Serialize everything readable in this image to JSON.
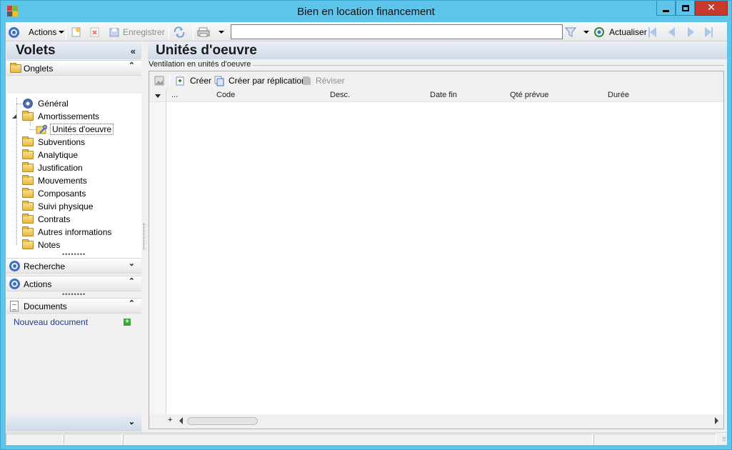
{
  "window": {
    "title": "Bien en location financement",
    "close_glyph": "✕"
  },
  "toolbar": {
    "actions_label": "Actions",
    "save_label": "Enregistrer",
    "search_value": "",
    "refresh_label": "Actualiser"
  },
  "left_pane": {
    "title": "Volets",
    "collapse_glyph": "«",
    "sections": {
      "tabs": {
        "label": "Onglets",
        "chevron": "⌃"
      },
      "search": {
        "label": "Recherche",
        "chevron": "⌄"
      },
      "actions": {
        "label": "Actions",
        "chevron": "⌃"
      },
      "documents": {
        "label": "Documents",
        "chevron": "⌃"
      }
    },
    "tree": [
      "Général",
      "Amortissements",
      "Unités d'oeuvre",
      "Subventions",
      "Analytique",
      "Justification",
      "Mouvements",
      "Composants",
      "Suivi physique",
      "Contrats",
      "Autres informations",
      "Notes"
    ],
    "documents_link": "Nouveau document",
    "bottom_chevron": "⌄"
  },
  "main": {
    "title": "Unités d'oeuvre",
    "group_label": "Ventilation en unités d'oeuvre",
    "grid_tools": {
      "create": "Créer",
      "create_replication": "Créer par réplication",
      "revise": "Réviser"
    },
    "columns": [
      "...",
      "Code",
      "Desc.",
      "Date fin",
      "Qté prévue",
      "Durée"
    ]
  },
  "colors": {
    "title_bar": "#5fc4ea",
    "close_button": "#c7392c",
    "accent": "#3a6fc4",
    "link": "#1d3e8f"
  }
}
